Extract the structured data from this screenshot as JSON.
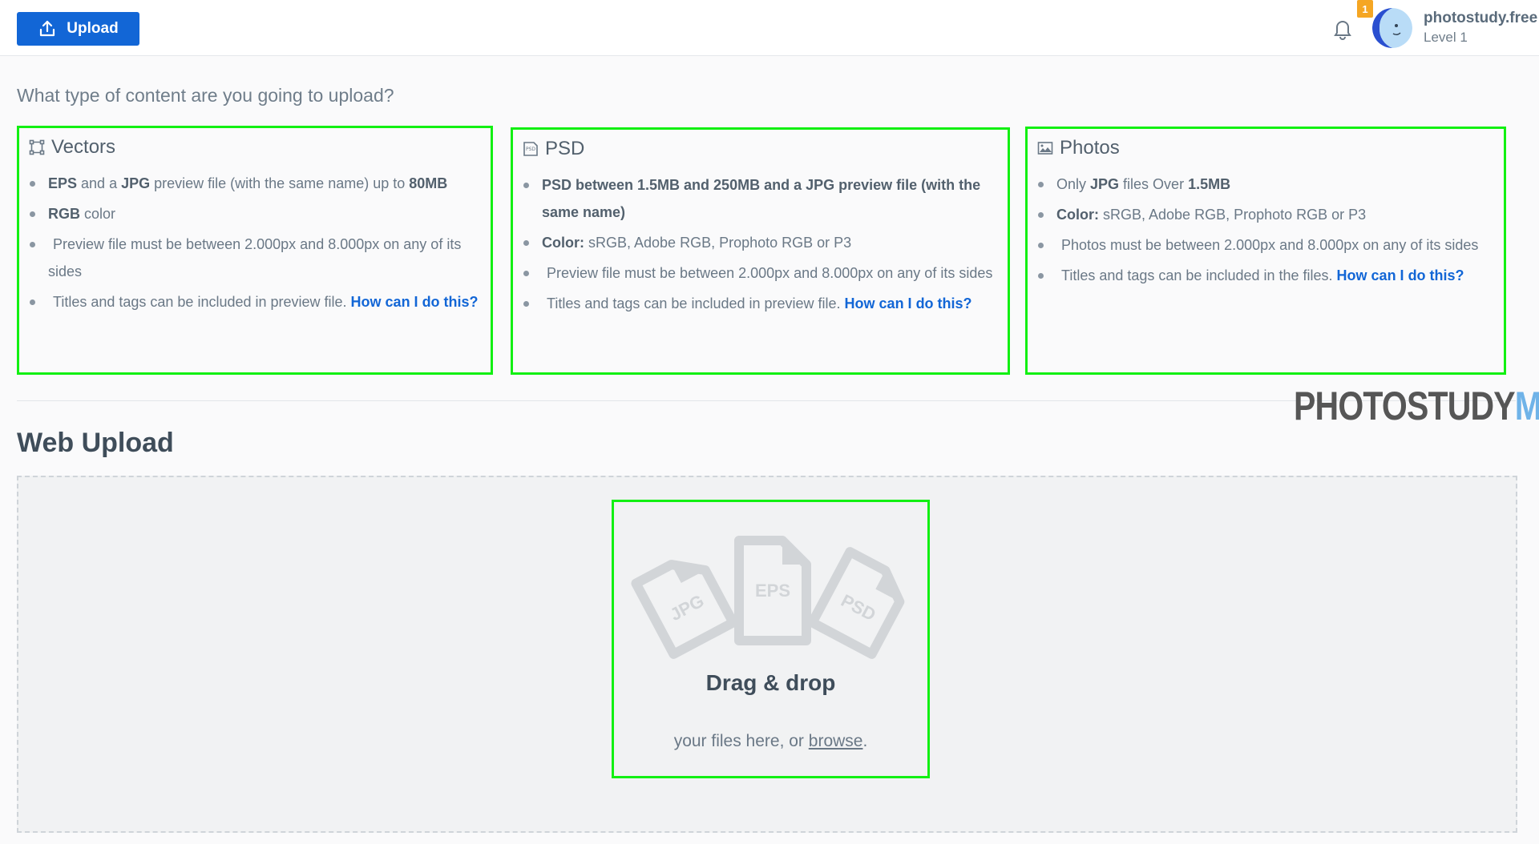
{
  "header": {
    "upload_label": "Upload",
    "notification_count": "1",
    "username": "photostudy.free",
    "level": "Level 1"
  },
  "question": "What type of content are you going to upload?",
  "cards": {
    "vectors": {
      "title": "Vectors",
      "items": [
        {
          "b1": "EPS",
          "t1": " and a ",
          "b2": "JPG",
          "t2": " preview file (with the same name) up to ",
          "b3": "80MB"
        },
        {
          "b1": "RGB",
          "t1": " color"
        },
        {
          "t1": "Preview file must be between 2.000px and 8.000px on any of its sides"
        },
        {
          "t1": "Titles and tags can be included in preview file. ",
          "link": "How can I do this?"
        }
      ]
    },
    "psd": {
      "title": "PSD",
      "items": [
        {
          "b1": "PSD between 1.5MB and 250MB and a JPG preview file (with the same name)"
        },
        {
          "b1": "Color:",
          "t1": " sRGB, Adobe RGB, Prophoto RGB or P3"
        },
        {
          "t1": "Preview file must be between 2.000px and 8.000px on any of its sides"
        },
        {
          "t1": "Titles and tags can be included in preview file. ",
          "link": "How can I do this?"
        }
      ]
    },
    "photos": {
      "title": "Photos",
      "items": [
        {
          "t0": "Only ",
          "b1": "JPG",
          "t1": " files Over ",
          "b2": "1.5MB"
        },
        {
          "b1": "Color:",
          "t1": " sRGB, Adobe RGB, Prophoto RGB or P3"
        },
        {
          "t1": "Photos must be between 2.000px and 8.000px on any of its sides"
        },
        {
          "t1": "Titles and tags can be included in the files. ",
          "link": "How can I do this?"
        }
      ]
    }
  },
  "brand": {
    "part1": "PHOTOSTUDY",
    "part2": "ME"
  },
  "web_upload": {
    "title": "Web Upload",
    "file_types": [
      "JPG",
      "EPS",
      "PSD"
    ],
    "drag_title": "Drag & drop",
    "sub_prefix": "your files here, or ",
    "browse": "browse",
    "sub_suffix": "."
  },
  "colors": {
    "accent": "#1266d6",
    "highlight": "#12f012",
    "badge": "#f5a623"
  },
  "icons": [
    "upload-icon",
    "bell-icon",
    "vector-icon",
    "psd-file-icon",
    "image-icon"
  ]
}
